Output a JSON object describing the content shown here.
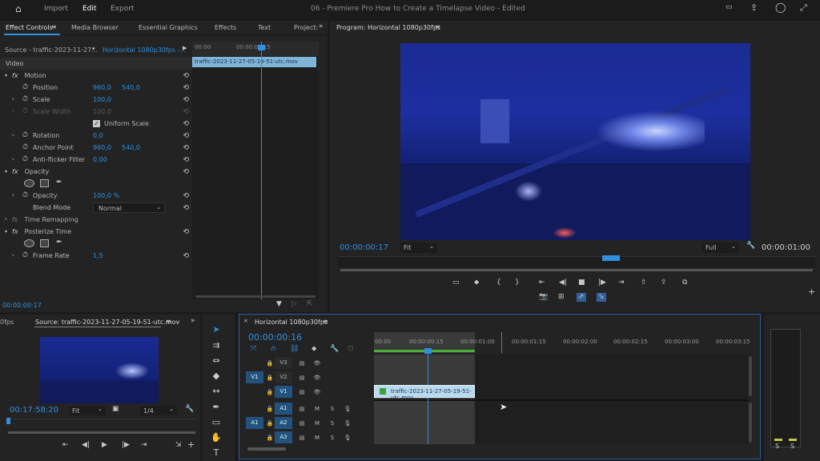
{
  "topbar": {
    "home": "home-icon",
    "import": "Import",
    "edit": "Edit",
    "export": "Export",
    "title": "06 - Premiere Pro How to Create a Timelapse Video",
    "edited": "- Edited"
  },
  "effect_controls": {
    "tabs": [
      "Effect Controls",
      "Media Browser",
      "Essential Graphics",
      "Effects",
      "Text",
      "Project:"
    ],
    "source_label": "Source - traffic-2023-11-27...",
    "sequence_label": "Horizontal 1080p30fps -...",
    "clip_name": "traffic-2023-11-27-05-19-51-utc.mov",
    "ruler": [
      "00:00",
      "00:00:00:15"
    ],
    "video": "Video",
    "motion": "Motion",
    "position": "Position",
    "pos_x": "960,0",
    "pos_y": "540,0",
    "scale": "Scale",
    "scale_v": "100,0",
    "scale_width": "Scale Width",
    "scale_width_v": "100,0",
    "uniform": "Uniform Scale",
    "rotation": "Rotation",
    "rotation_v": "0,0",
    "anchor": "Anchor Point",
    "anchor_x": "960,0",
    "anchor_y": "540,0",
    "anti": "Anti-flicker Filter",
    "anti_v": "0,00",
    "opacity_group": "Opacity",
    "opacity": "Opacity",
    "opacity_v": "100,0 %",
    "blend": "Blend Mode",
    "blend_v": "Normal",
    "time_remap": "Time Remapping",
    "posterize": "Posterize Time",
    "frame_rate": "Frame Rate",
    "frame_rate_v": "1,5",
    "timecode": "00:00:00:17"
  },
  "program": {
    "title": "Program: Horizontal 1080p30fps",
    "timecode": "00:00:00:17",
    "fit": "Fit",
    "full": "Full",
    "duration": "00:00:01:00"
  },
  "source": {
    "fps_label": "0fps",
    "title": "Source: traffic-2023-11-27-05-19-51-utc.mov",
    "timecode": "00:17:58:20",
    "fit": "Fit",
    "ratio": "1/4"
  },
  "timeline": {
    "title": "Horizontal 1080p30fps",
    "timecode": "00:00:00:16",
    "ruler": [
      "00:00",
      "00:00:00:15",
      "00:00:01:00",
      "00:00:01:15",
      "00:00:02:00",
      "00:00:02:15",
      "00:00:03:00",
      "00:00:03:15"
    ],
    "clip": "traffic-2023-11-27-05-19-51-utc.mov",
    "tracks": [
      "V3",
      "V2",
      "V1",
      "A1",
      "A2",
      "A3"
    ],
    "src_v": "V1",
    "src_a": "A1",
    "m": "M",
    "s": "S"
  },
  "meter": {
    "s1": "S",
    "s2": "S"
  },
  "colors": {
    "accent": "#2f8fe0",
    "clip": "#b9d9ee",
    "panel": "#232323"
  }
}
